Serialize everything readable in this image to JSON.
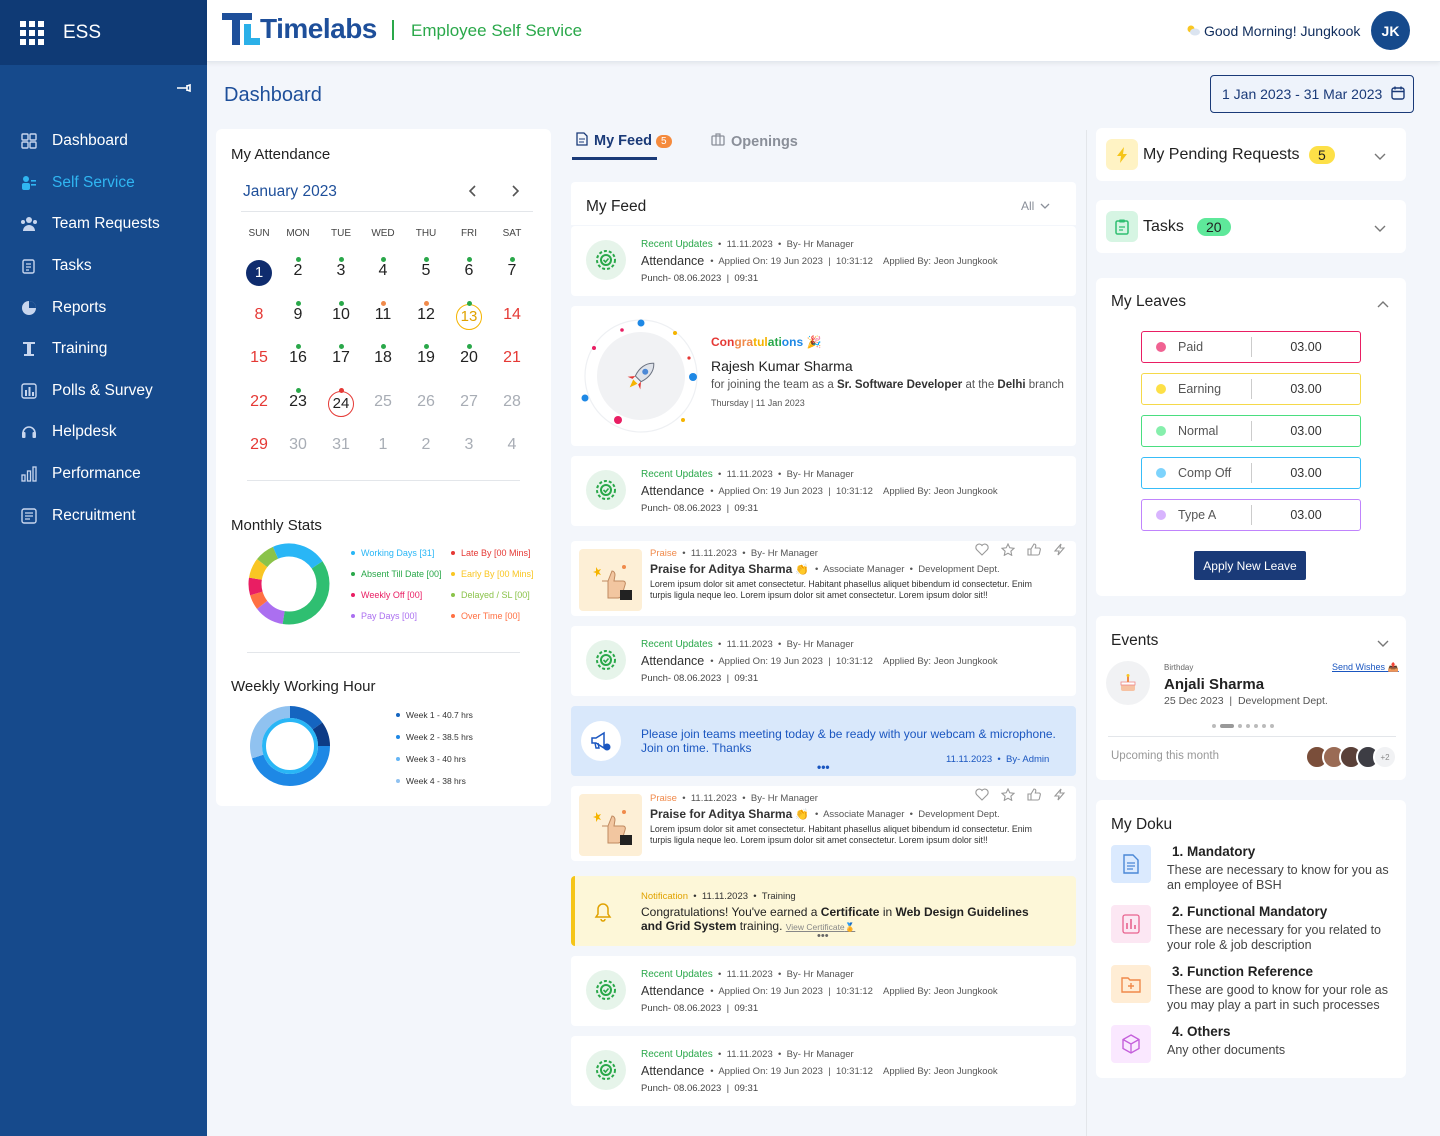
{
  "app": {
    "name": "ESS",
    "brand": "Timelabs",
    "subtitle": "Employee Self Service",
    "greeting": "Good Morning! Jungkook",
    "avatar": "JK"
  },
  "sidebar": {
    "items": [
      {
        "label": "Dashboard",
        "icon": "dashboard-icon"
      },
      {
        "label": "Self Service",
        "icon": "self-service-icon",
        "active": true
      },
      {
        "label": "Team Requests",
        "icon": "team-icon"
      },
      {
        "label": "Tasks",
        "icon": "tasks-icon"
      },
      {
        "label": "Reports",
        "icon": "reports-icon"
      },
      {
        "label": "Training",
        "icon": "training-icon"
      },
      {
        "label": "Polls & Survey",
        "icon": "polls-icon"
      },
      {
        "label": "Helpdesk",
        "icon": "helpdesk-icon"
      },
      {
        "label": "Performance",
        "icon": "performance-icon"
      },
      {
        "label": "Recruitment",
        "icon": "recruitment-icon"
      }
    ]
  },
  "page": {
    "title": "Dashboard",
    "date_range": "1 Jan 2023 - 31 Mar 2023"
  },
  "attendance": {
    "title": "My Attendance",
    "month": "January 2023",
    "weekdays": [
      "SUN",
      "MON",
      "TUE",
      "WED",
      "THU",
      "FRI",
      "SAT"
    ],
    "weeks": [
      [
        "1",
        "2",
        "3",
        "4",
        "5",
        "6",
        "7"
      ],
      [
        "8",
        "9",
        "10",
        "11",
        "12",
        "13",
        "14"
      ],
      [
        "15",
        "16",
        "17",
        "18",
        "19",
        "20",
        "21"
      ],
      [
        "22",
        "23",
        "24",
        "25",
        "26",
        "27",
        "28"
      ],
      [
        "29",
        "30",
        "31",
        "1",
        "2",
        "3",
        "4"
      ]
    ]
  },
  "monthly_stats": {
    "title": "Monthly Stats",
    "legend": [
      {
        "label": "Working Days [31]",
        "color": "#29b6f6"
      },
      {
        "label": "Late By [00 Mins]",
        "color": "#e53935"
      },
      {
        "label": "Absent Till Date [00]",
        "color": "#2aa84a"
      },
      {
        "label": "Early By [00 Mins]",
        "color": "#f9c623"
      },
      {
        "label": "Weekly Off [00]",
        "color": "#e91e63"
      },
      {
        "label": "Delayed / SL [00]",
        "color": "#8bc34a"
      },
      {
        "label": "Pay Days [00]",
        "color": "#ab6ff0"
      },
      {
        "label": "Over Time [00]",
        "color": "#ff7043"
      }
    ]
  },
  "weekly": {
    "title": "Weekly Working Hour",
    "legend": [
      "Week 1 - 40.7 hrs",
      "Week 2 - 38.5 hrs",
      "Week 3 - 40 hrs",
      "Week 4 - 38 hrs"
    ]
  },
  "feed_tabs": {
    "my_feed": "My Feed",
    "count": "5",
    "openings": "Openings"
  },
  "feed": {
    "title": "My Feed",
    "filter": "All",
    "update": {
      "tag": "Recent Updates",
      "date": "11.11.2023",
      "by": "By- Hr Manager",
      "type": "Attendance",
      "applied_on": "Applied On: 19 Jun 2023",
      "time": "10:31:12",
      "applied_by": "Applied By: Jeon Jungkook",
      "punch": "Punch- 08.06.2023",
      "punch_time": "09:31"
    },
    "congrats": {
      "tag": "Congratulations",
      "name": "Rajesh Kumar Sharma",
      "text1": "for joining the team as a",
      "role": "Sr. Software Developer",
      "text2": "at the",
      "place": "Delhi",
      "text3": "branch",
      "date": "Thursday | 11 Jan 2023"
    },
    "praise": {
      "tag": "Praise",
      "date": "11.11.2023",
      "by": "By- Hr Manager",
      "title": "Praise for Aditya Sharma",
      "role": "Associate Manager",
      "dept": "Development Dept.",
      "body": "Lorem ipsum dolor sit amet consectetur. Habitant phasellus aliquet bibendum id consectetur. Enim turpis ligula neque leo. Lorem ipsum dolor sit amet consectetur. Lorem ipsum dolor sit!!"
    },
    "announcement": {
      "text": "Please join teams meeting today & be ready with your webcam & microphone. Join on time. Thanks",
      "date": "11.11.2023",
      "by": "By- Admin"
    },
    "notification": {
      "tag": "Notification",
      "date": "11.11.2023",
      "category": "Training",
      "text1": "Congratulations! You've earned a",
      "cert": "Certificate",
      "text2": "in",
      "course": "Web Design Guidelines and Grid System",
      "text3": "training.",
      "link": "View Certificate"
    }
  },
  "right": {
    "pending": {
      "title": "My Pending Requests",
      "count": "5"
    },
    "tasks": {
      "title": "Tasks",
      "count": "20"
    },
    "leaves": {
      "title": "My Leaves",
      "items": [
        {
          "label": "Paid",
          "value": "03.00",
          "color": "#f06292",
          "border": "#e91e63"
        },
        {
          "label": "Earning",
          "value": "03.00",
          "color": "#fde047",
          "border": "#f5d94a"
        },
        {
          "label": "Normal",
          "value": "03.00",
          "color": "#86efac",
          "border": "#4ade80"
        },
        {
          "label": "Comp Off",
          "value": "03.00",
          "color": "#7dd3fc",
          "border": "#38bdf8"
        },
        {
          "label": "Type A",
          "value": "03.00",
          "color": "#d8b4fe",
          "border": "#c084fc"
        }
      ],
      "button": "Apply New Leave"
    },
    "events": {
      "title": "Events",
      "tag": "Birthday",
      "link": "Send Wishes",
      "name": "Anjali Sharma",
      "date": "25 Dec 2023",
      "dept": "Development Dept.",
      "upcoming": "Upcoming this month",
      "more": "+2"
    },
    "doku": {
      "title": "My Doku",
      "items": [
        {
          "title": "1. Mandatory",
          "desc": "These are necessary to know for you as an employee of BSH",
          "bg": "#dbeafe",
          "fg": "#4b88d6"
        },
        {
          "title": "2. Functional Mandatory",
          "desc": "These are necessary for you related to your role & job description",
          "bg": "#fce7f3",
          "fg": "#e8638f"
        },
        {
          "title": "3. Function Reference",
          "desc": "These are good to know for your role as you may play a part in such processes",
          "bg": "#ffedd5",
          "fg": "#f08a4b"
        },
        {
          "title": "4. Others",
          "desc": "Any other documents",
          "bg": "#fae8ff",
          "fg": "#c45fdb"
        }
      ]
    }
  },
  "colors": {
    "primary": "#164a8c",
    "accent": "#30b6f2",
    "green": "#2aa84a",
    "navy": "#1a3a78"
  }
}
